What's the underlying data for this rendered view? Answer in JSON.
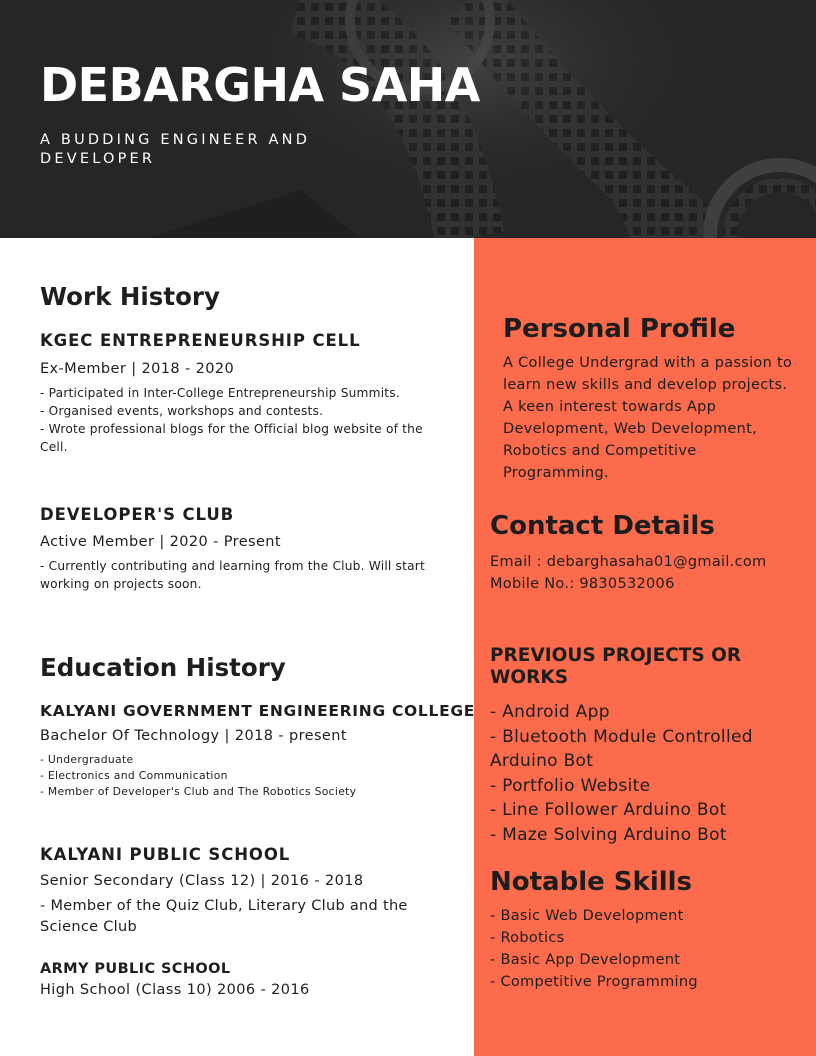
{
  "header": {
    "name": "DEBARGHA SAHA",
    "tagline": "A BUDDING ENGINEER AND DEVELOPER"
  },
  "work_history": {
    "title": "Work History",
    "entries": [
      {
        "org": "KGEC ENTREPRENEURSHIP CELL",
        "role": "Ex-Member | 2018 - 2020",
        "points": [
          "- Participated in Inter-College Entrepreneurship Summits.",
          "- Organised events, workshops and contests.",
          "- Wrote professional blogs for the Official blog website of the Cell."
        ]
      },
      {
        "org": "DEVELOPER'S CLUB",
        "role": "Active Member | 2020 - Present",
        "points": [
          "- Currently contributing and learning from the Club. Will start working on projects soon."
        ]
      }
    ]
  },
  "education_history": {
    "title": "Education History",
    "entries": [
      {
        "org": "KALYANI GOVERNMENT ENGINEERING COLLEGE",
        "role": "Bachelor Of Technology | 2018 - present",
        "points": [
          "- Undergraduate",
          "- Electronics and Communication",
          "- Member of Developer's Club and The Robotics Society"
        ]
      },
      {
        "org": "KALYANI PUBLIC SCHOOL",
        "role": "Senior Secondary (Class 12) | 2016 - 2018",
        "points": [
          "- Member of the Quiz Club, Literary Club and the Science Club"
        ]
      },
      {
        "org": "ARMY PUBLIC SCHOOL",
        "role": "High School (Class 10)  2006 - 2016",
        "points": []
      }
    ]
  },
  "personal_profile": {
    "title": "Personal Profile",
    "text": "A College Undergrad with a passion to learn new skills and develop projects. A keen interest towards App Development, Web Development, Robotics and Competitive Programming."
  },
  "contact": {
    "title": "Contact Details",
    "email": "Email : debarghasaha01@gmail.com",
    "mobile": "Mobile No.: 9830532006"
  },
  "projects": {
    "title": "PREVIOUS PROJECTS OR WORKS",
    "items": [
      "- Android App",
      "- Bluetooth Module Controlled Arduino Bot",
      "- Portfolio Website",
      "-  Line Follower Arduino Bot",
      "-  Maze Solving Arduino Bot"
    ]
  },
  "skills": {
    "title": "Notable Skills",
    "items": [
      "- Basic Web Development",
      "- Robotics",
      "- Basic App Development",
      "- Competitive Programming"
    ]
  },
  "colors": {
    "header_bg": "#262626",
    "accent": "#fb6b4c",
    "text": "#1e1e1e"
  }
}
